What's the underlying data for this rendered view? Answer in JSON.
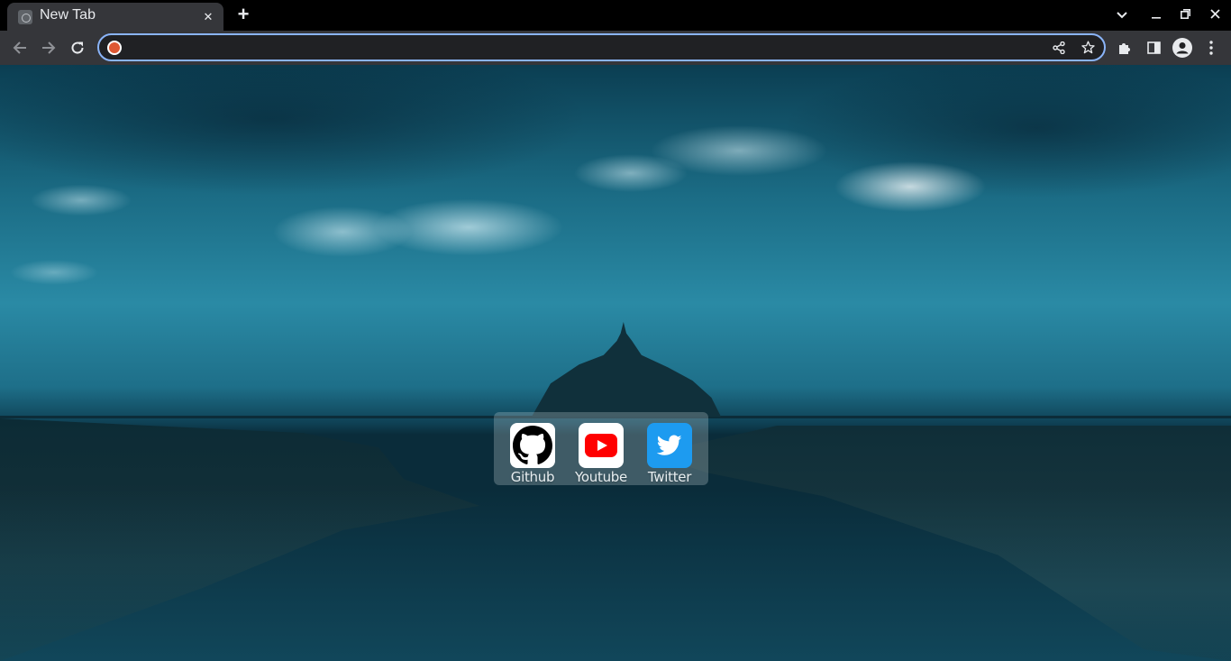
{
  "browser": {
    "tab": {
      "title": "New Tab"
    },
    "omnibox": {
      "value": ""
    }
  },
  "bookmarks": [
    {
      "label": "Github",
      "icon": "github-icon",
      "color": "#ffffff"
    },
    {
      "label": "Youtube",
      "icon": "youtube-icon",
      "color": "#ff0000"
    },
    {
      "label": "Twitter",
      "icon": "twitter-icon",
      "color": "#1d9bf0"
    }
  ],
  "colors": {
    "accent": "#8ab4f8",
    "toolbar": "#35363a",
    "tabstrip": "#000000"
  }
}
